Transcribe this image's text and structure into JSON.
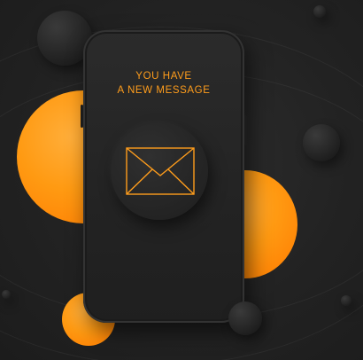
{
  "notification": {
    "line1": "YOU HAVE",
    "line2": "A NEW MESSAGE"
  },
  "icons": {
    "message": "envelope-icon"
  },
  "colors": {
    "background": "#232323",
    "accent": "#ff9d1c",
    "orange": "#ff8c00"
  }
}
